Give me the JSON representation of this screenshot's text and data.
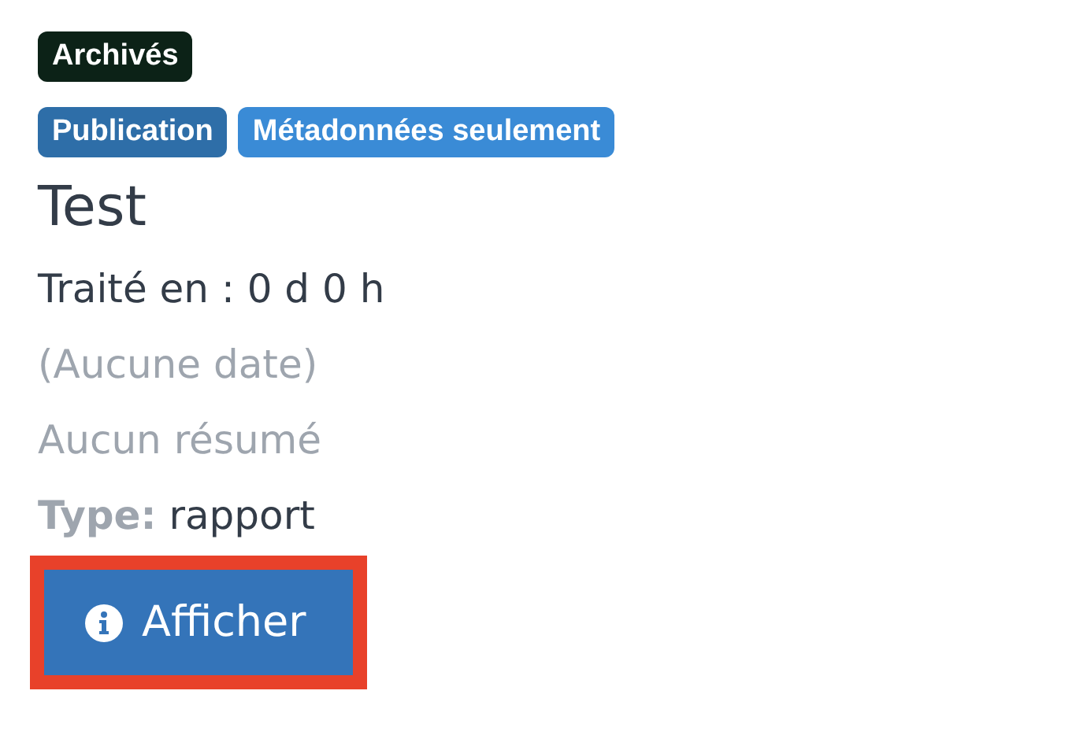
{
  "status_badges": [
    {
      "label": "Archivés",
      "color": "#0c2217"
    }
  ],
  "tags": [
    {
      "label": "Publication",
      "color": "#2e6ea8"
    },
    {
      "label": "Métadonnées seulement",
      "color": "#3a8bd6"
    }
  ],
  "title": "Test",
  "processed": "Traité en : 0 d 0 h",
  "date": "(Aucune date)",
  "summary": "Aucun résumé",
  "type": {
    "label": "Type:",
    "value": "rapport"
  },
  "button": {
    "label": "Afficher",
    "highlighted": true
  }
}
